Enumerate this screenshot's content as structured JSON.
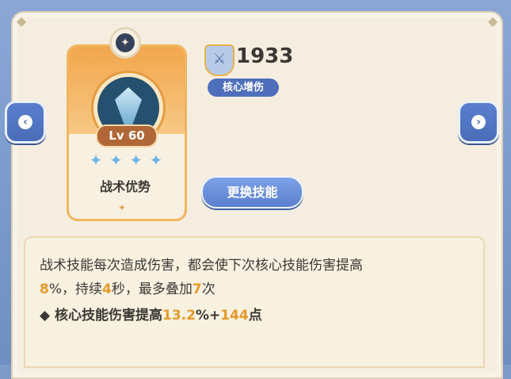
{
  "nav": {
    "left_icon": "chevron-left-icon",
    "right_icon": "chevron-right-icon"
  },
  "card": {
    "badge_icon": "star-emblem-icon",
    "skill_icon": "crystal-sword-icon",
    "level": "Lv 60",
    "stars": 4,
    "skill_name": "战术优势"
  },
  "power": {
    "icon": "shield-sword-icon",
    "value": "1933"
  },
  "tag": "核心增伤",
  "buttons": {
    "change_skill": "更换技能"
  },
  "description": {
    "line1": "战术技能每次造成伤害，都会使下次核心技能伤害提高",
    "line2_pre": "8",
    "line2_mid1": "%，持续",
    "line2_num1": "4",
    "line2_mid2": "秒，最多叠加",
    "line2_num2": "7",
    "line2_post": "次",
    "line3_pre": "◆ 核心技能伤害提高",
    "line3_num1": "13.2",
    "line3_mid": "%+",
    "line3_num2": "144",
    "line3_post": "点"
  },
  "colors": {
    "accent": "#4f6fbc",
    "highlight": "#e49a2a",
    "card_orange": "#f2a64c"
  }
}
